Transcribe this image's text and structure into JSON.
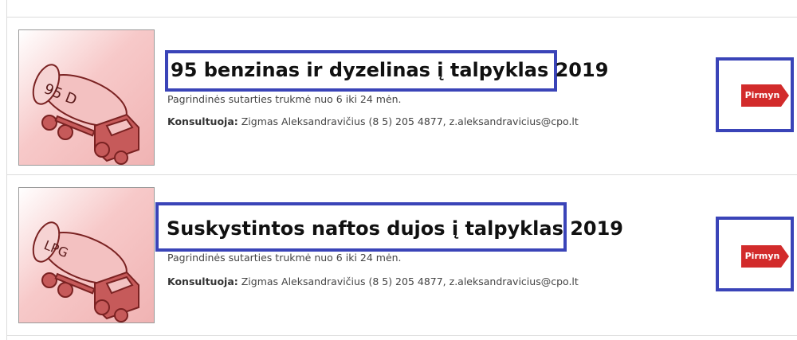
{
  "items": [
    {
      "thumb_label": "95  D",
      "title": "95 benzinas ir dyzelinas į talpyklas 2019",
      "duration": "Pagrindinės sutarties trukmė nuo 6 iki 24 mėn.",
      "consult_label": "Konsultuoja:",
      "consult_value": " Zigmas Aleksandravičius (8 5) 205 4877, z.aleksandravicius@cpo.lt",
      "button": "Pirmyn"
    },
    {
      "thumb_label": "LPG",
      "title": "Suskystintos naftos dujos į talpyklas 2019",
      "duration": "Pagrindinės sutarties trukmė nuo 6 iki 24 mėn.",
      "consult_label": "Konsultuoja:",
      "consult_value": " Zigmas Aleksandravičius (8 5) 205 4877, z.aleksandravicius@cpo.lt",
      "button": "Pirmyn"
    }
  ],
  "colors": {
    "highlight_border": "#3a44b8",
    "button_bg": "#d22b2b",
    "truck_fill": "#b84a4a"
  }
}
